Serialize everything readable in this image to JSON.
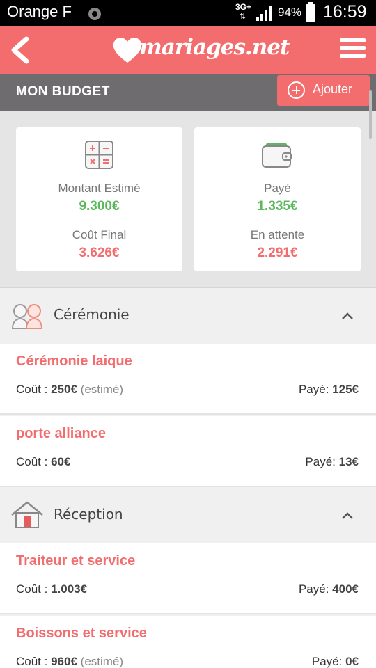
{
  "status_bar": {
    "carrier": "Orange F",
    "network": "3G+",
    "battery": "94%",
    "time": "16:59"
  },
  "header": {
    "logo_text": "mariages.net"
  },
  "page": {
    "title": "MON BUDGET",
    "add_label": "Ajouter"
  },
  "summary": {
    "estimated_label": "Montant Estimé",
    "estimated_value": "9.300€",
    "final_label": "Coût Final",
    "final_value": "3.626€",
    "paid_label": "Payé",
    "paid_value": "1.335€",
    "pending_label": "En attente",
    "pending_value": "2.291€"
  },
  "labels": {
    "cost": "Coût :",
    "paid": "Payé:",
    "estimated": "(estimé)"
  },
  "sections": [
    {
      "title": "Cérémonie",
      "items": [
        {
          "name": "Cérémonie laique",
          "cost": "250€",
          "estimated": true,
          "paid": "125€"
        },
        {
          "name": "porte alliance",
          "cost": "60€",
          "estimated": false,
          "paid": "13€"
        }
      ]
    },
    {
      "title": "Réception",
      "items": [
        {
          "name": "Traiteur et service",
          "cost": "1.003€",
          "estimated": false,
          "paid": "400€"
        },
        {
          "name": "Boissons et service",
          "cost": "960€",
          "estimated": true,
          "paid": "0€"
        }
      ]
    }
  ],
  "colors": {
    "accent": "#f36c6e",
    "title_bar": "#6f6c70",
    "positive": "#5cb85c"
  }
}
